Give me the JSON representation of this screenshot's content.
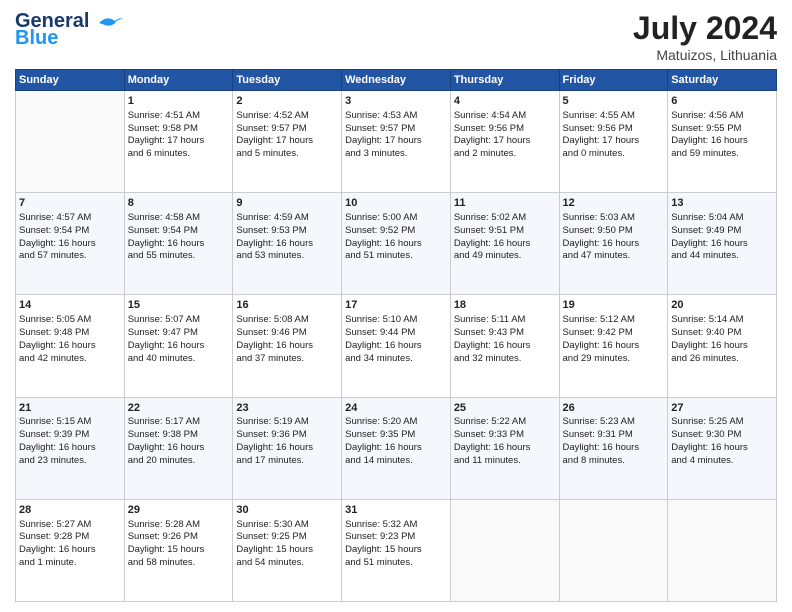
{
  "header": {
    "logo_line1": "General",
    "logo_line2": "Blue",
    "month_year": "July 2024",
    "location": "Matuizos, Lithuania"
  },
  "days_of_week": [
    "Sunday",
    "Monday",
    "Tuesday",
    "Wednesday",
    "Thursday",
    "Friday",
    "Saturday"
  ],
  "weeks": [
    [
      {
        "day": "",
        "content": ""
      },
      {
        "day": "1",
        "content": "Sunrise: 4:51 AM\nSunset: 9:58 PM\nDaylight: 17 hours\nand 6 minutes."
      },
      {
        "day": "2",
        "content": "Sunrise: 4:52 AM\nSunset: 9:57 PM\nDaylight: 17 hours\nand 5 minutes."
      },
      {
        "day": "3",
        "content": "Sunrise: 4:53 AM\nSunset: 9:57 PM\nDaylight: 17 hours\nand 3 minutes."
      },
      {
        "day": "4",
        "content": "Sunrise: 4:54 AM\nSunset: 9:56 PM\nDaylight: 17 hours\nand 2 minutes."
      },
      {
        "day": "5",
        "content": "Sunrise: 4:55 AM\nSunset: 9:56 PM\nDaylight: 17 hours\nand 0 minutes."
      },
      {
        "day": "6",
        "content": "Sunrise: 4:56 AM\nSunset: 9:55 PM\nDaylight: 16 hours\nand 59 minutes."
      }
    ],
    [
      {
        "day": "7",
        "content": "Sunrise: 4:57 AM\nSunset: 9:54 PM\nDaylight: 16 hours\nand 57 minutes."
      },
      {
        "day": "8",
        "content": "Sunrise: 4:58 AM\nSunset: 9:54 PM\nDaylight: 16 hours\nand 55 minutes."
      },
      {
        "day": "9",
        "content": "Sunrise: 4:59 AM\nSunset: 9:53 PM\nDaylight: 16 hours\nand 53 minutes."
      },
      {
        "day": "10",
        "content": "Sunrise: 5:00 AM\nSunset: 9:52 PM\nDaylight: 16 hours\nand 51 minutes."
      },
      {
        "day": "11",
        "content": "Sunrise: 5:02 AM\nSunset: 9:51 PM\nDaylight: 16 hours\nand 49 minutes."
      },
      {
        "day": "12",
        "content": "Sunrise: 5:03 AM\nSunset: 9:50 PM\nDaylight: 16 hours\nand 47 minutes."
      },
      {
        "day": "13",
        "content": "Sunrise: 5:04 AM\nSunset: 9:49 PM\nDaylight: 16 hours\nand 44 minutes."
      }
    ],
    [
      {
        "day": "14",
        "content": "Sunrise: 5:05 AM\nSunset: 9:48 PM\nDaylight: 16 hours\nand 42 minutes."
      },
      {
        "day": "15",
        "content": "Sunrise: 5:07 AM\nSunset: 9:47 PM\nDaylight: 16 hours\nand 40 minutes."
      },
      {
        "day": "16",
        "content": "Sunrise: 5:08 AM\nSunset: 9:46 PM\nDaylight: 16 hours\nand 37 minutes."
      },
      {
        "day": "17",
        "content": "Sunrise: 5:10 AM\nSunset: 9:44 PM\nDaylight: 16 hours\nand 34 minutes."
      },
      {
        "day": "18",
        "content": "Sunrise: 5:11 AM\nSunset: 9:43 PM\nDaylight: 16 hours\nand 32 minutes."
      },
      {
        "day": "19",
        "content": "Sunrise: 5:12 AM\nSunset: 9:42 PM\nDaylight: 16 hours\nand 29 minutes."
      },
      {
        "day": "20",
        "content": "Sunrise: 5:14 AM\nSunset: 9:40 PM\nDaylight: 16 hours\nand 26 minutes."
      }
    ],
    [
      {
        "day": "21",
        "content": "Sunrise: 5:15 AM\nSunset: 9:39 PM\nDaylight: 16 hours\nand 23 minutes."
      },
      {
        "day": "22",
        "content": "Sunrise: 5:17 AM\nSunset: 9:38 PM\nDaylight: 16 hours\nand 20 minutes."
      },
      {
        "day": "23",
        "content": "Sunrise: 5:19 AM\nSunset: 9:36 PM\nDaylight: 16 hours\nand 17 minutes."
      },
      {
        "day": "24",
        "content": "Sunrise: 5:20 AM\nSunset: 9:35 PM\nDaylight: 16 hours\nand 14 minutes."
      },
      {
        "day": "25",
        "content": "Sunrise: 5:22 AM\nSunset: 9:33 PM\nDaylight: 16 hours\nand 11 minutes."
      },
      {
        "day": "26",
        "content": "Sunrise: 5:23 AM\nSunset: 9:31 PM\nDaylight: 16 hours\nand 8 minutes."
      },
      {
        "day": "27",
        "content": "Sunrise: 5:25 AM\nSunset: 9:30 PM\nDaylight: 16 hours\nand 4 minutes."
      }
    ],
    [
      {
        "day": "28",
        "content": "Sunrise: 5:27 AM\nSunset: 9:28 PM\nDaylight: 16 hours\nand 1 minute."
      },
      {
        "day": "29",
        "content": "Sunrise: 5:28 AM\nSunset: 9:26 PM\nDaylight: 15 hours\nand 58 minutes."
      },
      {
        "day": "30",
        "content": "Sunrise: 5:30 AM\nSunset: 9:25 PM\nDaylight: 15 hours\nand 54 minutes."
      },
      {
        "day": "31",
        "content": "Sunrise: 5:32 AM\nSunset: 9:23 PM\nDaylight: 15 hours\nand 51 minutes."
      },
      {
        "day": "",
        "content": ""
      },
      {
        "day": "",
        "content": ""
      },
      {
        "day": "",
        "content": ""
      }
    ]
  ]
}
